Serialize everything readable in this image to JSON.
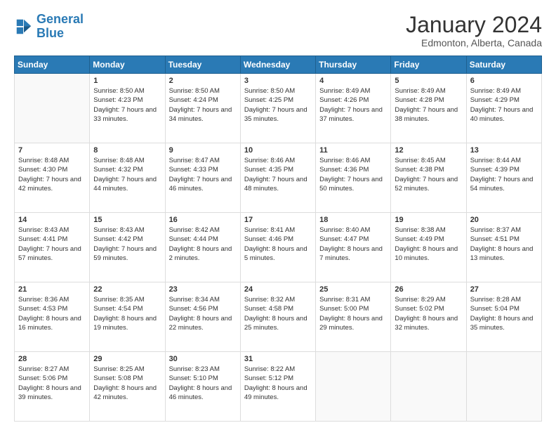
{
  "header": {
    "logo_general": "General",
    "logo_blue": "Blue",
    "month": "January 2024",
    "location": "Edmonton, Alberta, Canada"
  },
  "weekdays": [
    "Sunday",
    "Monday",
    "Tuesday",
    "Wednesday",
    "Thursday",
    "Friday",
    "Saturday"
  ],
  "weeks": [
    [
      {
        "day": "",
        "sunrise": "",
        "sunset": "",
        "daylight": ""
      },
      {
        "day": "1",
        "sunrise": "Sunrise: 8:50 AM",
        "sunset": "Sunset: 4:23 PM",
        "daylight": "Daylight: 7 hours and 33 minutes."
      },
      {
        "day": "2",
        "sunrise": "Sunrise: 8:50 AM",
        "sunset": "Sunset: 4:24 PM",
        "daylight": "Daylight: 7 hours and 34 minutes."
      },
      {
        "day": "3",
        "sunrise": "Sunrise: 8:50 AM",
        "sunset": "Sunset: 4:25 PM",
        "daylight": "Daylight: 7 hours and 35 minutes."
      },
      {
        "day": "4",
        "sunrise": "Sunrise: 8:49 AM",
        "sunset": "Sunset: 4:26 PM",
        "daylight": "Daylight: 7 hours and 37 minutes."
      },
      {
        "day": "5",
        "sunrise": "Sunrise: 8:49 AM",
        "sunset": "Sunset: 4:28 PM",
        "daylight": "Daylight: 7 hours and 38 minutes."
      },
      {
        "day": "6",
        "sunrise": "Sunrise: 8:49 AM",
        "sunset": "Sunset: 4:29 PM",
        "daylight": "Daylight: 7 hours and 40 minutes."
      }
    ],
    [
      {
        "day": "7",
        "sunrise": "Sunrise: 8:48 AM",
        "sunset": "Sunset: 4:30 PM",
        "daylight": "Daylight: 7 hours and 42 minutes."
      },
      {
        "day": "8",
        "sunrise": "Sunrise: 8:48 AM",
        "sunset": "Sunset: 4:32 PM",
        "daylight": "Daylight: 7 hours and 44 minutes."
      },
      {
        "day": "9",
        "sunrise": "Sunrise: 8:47 AM",
        "sunset": "Sunset: 4:33 PM",
        "daylight": "Daylight: 7 hours and 46 minutes."
      },
      {
        "day": "10",
        "sunrise": "Sunrise: 8:46 AM",
        "sunset": "Sunset: 4:35 PM",
        "daylight": "Daylight: 7 hours and 48 minutes."
      },
      {
        "day": "11",
        "sunrise": "Sunrise: 8:46 AM",
        "sunset": "Sunset: 4:36 PM",
        "daylight": "Daylight: 7 hours and 50 minutes."
      },
      {
        "day": "12",
        "sunrise": "Sunrise: 8:45 AM",
        "sunset": "Sunset: 4:38 PM",
        "daylight": "Daylight: 7 hours and 52 minutes."
      },
      {
        "day": "13",
        "sunrise": "Sunrise: 8:44 AM",
        "sunset": "Sunset: 4:39 PM",
        "daylight": "Daylight: 7 hours and 54 minutes."
      }
    ],
    [
      {
        "day": "14",
        "sunrise": "Sunrise: 8:43 AM",
        "sunset": "Sunset: 4:41 PM",
        "daylight": "Daylight: 7 hours and 57 minutes."
      },
      {
        "day": "15",
        "sunrise": "Sunrise: 8:43 AM",
        "sunset": "Sunset: 4:42 PM",
        "daylight": "Daylight: 7 hours and 59 minutes."
      },
      {
        "day": "16",
        "sunrise": "Sunrise: 8:42 AM",
        "sunset": "Sunset: 4:44 PM",
        "daylight": "Daylight: 8 hours and 2 minutes."
      },
      {
        "day": "17",
        "sunrise": "Sunrise: 8:41 AM",
        "sunset": "Sunset: 4:46 PM",
        "daylight": "Daylight: 8 hours and 5 minutes."
      },
      {
        "day": "18",
        "sunrise": "Sunrise: 8:40 AM",
        "sunset": "Sunset: 4:47 PM",
        "daylight": "Daylight: 8 hours and 7 minutes."
      },
      {
        "day": "19",
        "sunrise": "Sunrise: 8:38 AM",
        "sunset": "Sunset: 4:49 PM",
        "daylight": "Daylight: 8 hours and 10 minutes."
      },
      {
        "day": "20",
        "sunrise": "Sunrise: 8:37 AM",
        "sunset": "Sunset: 4:51 PM",
        "daylight": "Daylight: 8 hours and 13 minutes."
      }
    ],
    [
      {
        "day": "21",
        "sunrise": "Sunrise: 8:36 AM",
        "sunset": "Sunset: 4:53 PM",
        "daylight": "Daylight: 8 hours and 16 minutes."
      },
      {
        "day": "22",
        "sunrise": "Sunrise: 8:35 AM",
        "sunset": "Sunset: 4:54 PM",
        "daylight": "Daylight: 8 hours and 19 minutes."
      },
      {
        "day": "23",
        "sunrise": "Sunrise: 8:34 AM",
        "sunset": "Sunset: 4:56 PM",
        "daylight": "Daylight: 8 hours and 22 minutes."
      },
      {
        "day": "24",
        "sunrise": "Sunrise: 8:32 AM",
        "sunset": "Sunset: 4:58 PM",
        "daylight": "Daylight: 8 hours and 25 minutes."
      },
      {
        "day": "25",
        "sunrise": "Sunrise: 8:31 AM",
        "sunset": "Sunset: 5:00 PM",
        "daylight": "Daylight: 8 hours and 29 minutes."
      },
      {
        "day": "26",
        "sunrise": "Sunrise: 8:29 AM",
        "sunset": "Sunset: 5:02 PM",
        "daylight": "Daylight: 8 hours and 32 minutes."
      },
      {
        "day": "27",
        "sunrise": "Sunrise: 8:28 AM",
        "sunset": "Sunset: 5:04 PM",
        "daylight": "Daylight: 8 hours and 35 minutes."
      }
    ],
    [
      {
        "day": "28",
        "sunrise": "Sunrise: 8:27 AM",
        "sunset": "Sunset: 5:06 PM",
        "daylight": "Daylight: 8 hours and 39 minutes."
      },
      {
        "day": "29",
        "sunrise": "Sunrise: 8:25 AM",
        "sunset": "Sunset: 5:08 PM",
        "daylight": "Daylight: 8 hours and 42 minutes."
      },
      {
        "day": "30",
        "sunrise": "Sunrise: 8:23 AM",
        "sunset": "Sunset: 5:10 PM",
        "daylight": "Daylight: 8 hours and 46 minutes."
      },
      {
        "day": "31",
        "sunrise": "Sunrise: 8:22 AM",
        "sunset": "Sunset: 5:12 PM",
        "daylight": "Daylight: 8 hours and 49 minutes."
      },
      {
        "day": "",
        "sunrise": "",
        "sunset": "",
        "daylight": ""
      },
      {
        "day": "",
        "sunrise": "",
        "sunset": "",
        "daylight": ""
      },
      {
        "day": "",
        "sunrise": "",
        "sunset": "",
        "daylight": ""
      }
    ]
  ]
}
